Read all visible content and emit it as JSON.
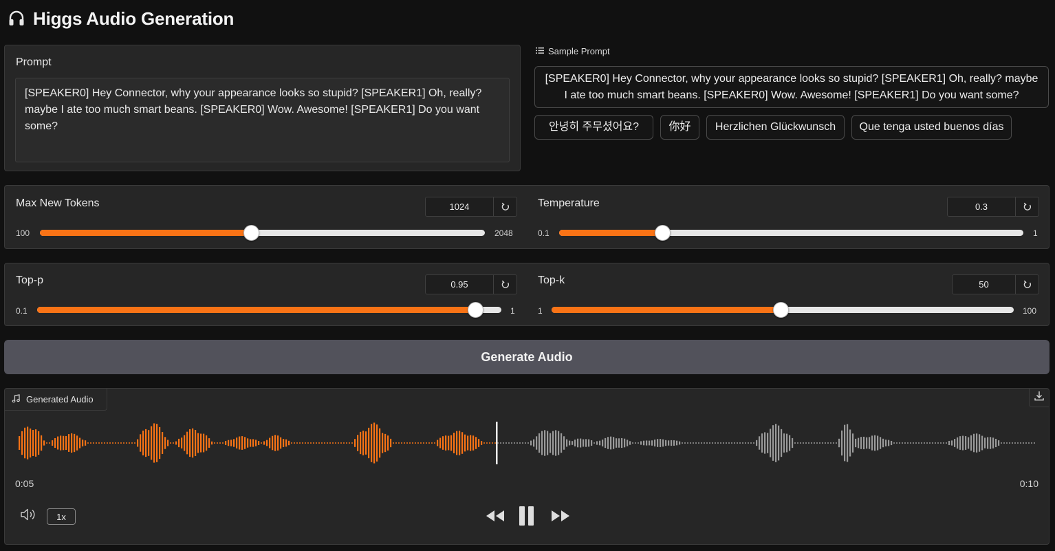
{
  "header": {
    "title": "Higgs Audio Generation",
    "icon": "headphones-icon"
  },
  "prompt": {
    "label": "Prompt",
    "value": "[SPEAKER0] Hey Connector, why your appearance looks so stupid? [SPEAKER1] Oh, really? maybe I ate too much smart beans. [SPEAKER0] Wow. Awesome! [SPEAKER1] Do you want some?"
  },
  "samples": {
    "label": "Sample Prompt",
    "items": [
      "[SPEAKER0] Hey Connector, why your appearance looks so stupid? [SPEAKER1] Oh, really? maybe I ate too much smart beans. [SPEAKER0] Wow. Awesome! [SPEAKER1] Do you want some?",
      "안녕히 주무셨어요?",
      "你好",
      "Herzlichen Glückwunsch",
      "Que tenga usted buenos días"
    ]
  },
  "sliders": {
    "max_tokens": {
      "label": "Max New Tokens",
      "value": "1024",
      "min": "100",
      "max": "2048",
      "fraction": 0.474
    },
    "temperature": {
      "label": "Temperature",
      "value": "0.3",
      "min": "0.1",
      "max": "1",
      "fraction": 0.222
    },
    "top_p": {
      "label": "Top-p",
      "value": "0.95",
      "min": "0.1",
      "max": "1",
      "fraction": 0.944
    },
    "top_k": {
      "label": "Top-k",
      "value": "50",
      "min": "1",
      "max": "100",
      "fraction": 0.495
    }
  },
  "generate": {
    "label": "Generate Audio"
  },
  "audio": {
    "label": "Generated Audio",
    "current_time": "0:05",
    "duration": "0:10",
    "progress": 0.5,
    "playback_rate": "1x"
  },
  "colors": {
    "accent": "#f97316",
    "background": "#111111",
    "panel": "#262626",
    "button": "#52525b",
    "waveform_unplayed": "#9a9a9a"
  }
}
